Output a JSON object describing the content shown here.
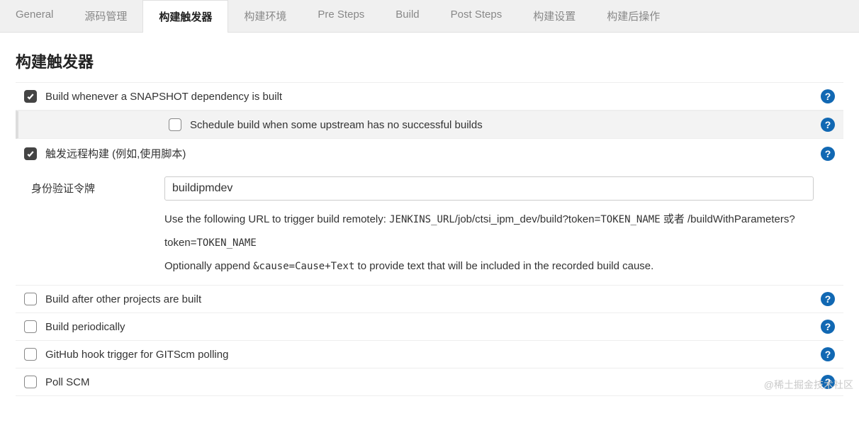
{
  "tabs": {
    "general": "General",
    "scm": "源码管理",
    "triggers": "构建触发器",
    "env": "构建环境",
    "presteps": "Pre Steps",
    "build": "Build",
    "poststeps": "Post Steps",
    "settings": "构建设置",
    "postactions": "构建后操作"
  },
  "section_title": "构建触发器",
  "triggers": {
    "snapshot": {
      "label": "Build whenever a SNAPSHOT dependency is built",
      "checked": true
    },
    "snapshot_sub": {
      "label": "Schedule build when some upstream has no successful builds",
      "checked": false
    },
    "remote": {
      "label": "触发远程构建 (例如,使用脚本)",
      "checked": true
    },
    "token_label": "身份验证令牌",
    "token_value": "buildipmdev",
    "remote_desc1_a": "Use the following URL to trigger build remotely: ",
    "remote_desc1_b": "JENKINS_URL",
    "remote_desc1_c": "/job/ctsi_ipm_dev/build?token=",
    "remote_desc1_d": "TOKEN_NAME",
    "remote_desc1_e": " 或者 /buildWithParameters?token=",
    "remote_desc1_f": "TOKEN_NAME",
    "remote_desc2_a": "Optionally append ",
    "remote_desc2_b": "&cause=Cause+Text",
    "remote_desc2_c": " to provide text that will be included in the recorded build cause.",
    "after_other": {
      "label": "Build after other projects are built",
      "checked": false
    },
    "periodically": {
      "label": "Build periodically",
      "checked": false
    },
    "github": {
      "label": "GitHub hook trigger for GITScm polling",
      "checked": false
    },
    "pollscm": {
      "label": "Poll SCM",
      "checked": false
    }
  },
  "help_glyph": "?",
  "watermark": "@稀土掘金技术社区"
}
